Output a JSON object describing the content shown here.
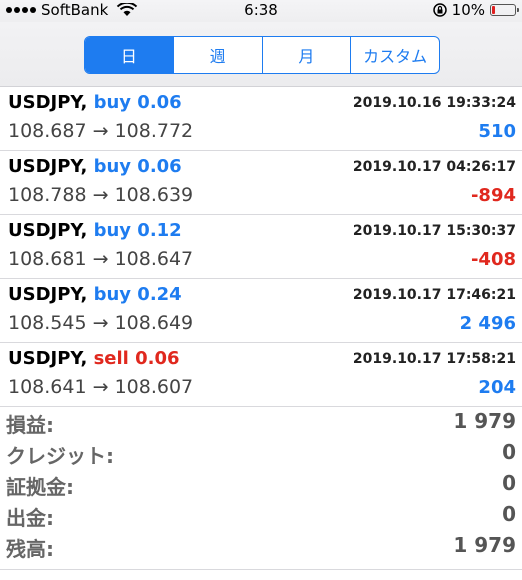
{
  "status": {
    "carrier": "SoftBank",
    "time": "6:38",
    "battery": "10%"
  },
  "tabs": [
    {
      "label": "日",
      "active": true
    },
    {
      "label": "週",
      "active": false
    },
    {
      "label": "月",
      "active": false
    },
    {
      "label": "カスタム",
      "active": false
    }
  ],
  "trades": [
    {
      "symbol": "USDJPY,",
      "side": "buy 0.06",
      "side_type": "buy",
      "date": "2019.10.16 19:33:24",
      "prices": "108.687 → 108.772",
      "profit": "510",
      "profit_sign": "pos"
    },
    {
      "symbol": "USDJPY,",
      "side": "buy 0.06",
      "side_type": "buy",
      "date": "2019.10.17 04:26:17",
      "prices": "108.788 → 108.639",
      "profit": "-894",
      "profit_sign": "neg"
    },
    {
      "symbol": "USDJPY,",
      "side": "buy 0.12",
      "side_type": "buy",
      "date": "2019.10.17 15:30:37",
      "prices": "108.681 → 108.647",
      "profit": "-408",
      "profit_sign": "neg"
    },
    {
      "symbol": "USDJPY,",
      "side": "buy 0.24",
      "side_type": "buy",
      "date": "2019.10.17 17:46:21",
      "prices": "108.545 → 108.649",
      "profit": "2 496",
      "profit_sign": "pos"
    },
    {
      "symbol": "USDJPY,",
      "side": "sell 0.06",
      "side_type": "sell",
      "date": "2019.10.17 17:58:21",
      "prices": "108.641 → 108.607",
      "profit": "204",
      "profit_sign": "pos"
    }
  ],
  "summary": [
    {
      "label": "損益:",
      "value": "1 979"
    },
    {
      "label": "クレジット:",
      "value": "0"
    },
    {
      "label": "証拠金:",
      "value": "0"
    },
    {
      "label": "出金:",
      "value": "0"
    },
    {
      "label": "残高:",
      "value": "1 979"
    }
  ],
  "colors": {
    "accent": "#1e7cf0",
    "negative": "#e0281e"
  }
}
